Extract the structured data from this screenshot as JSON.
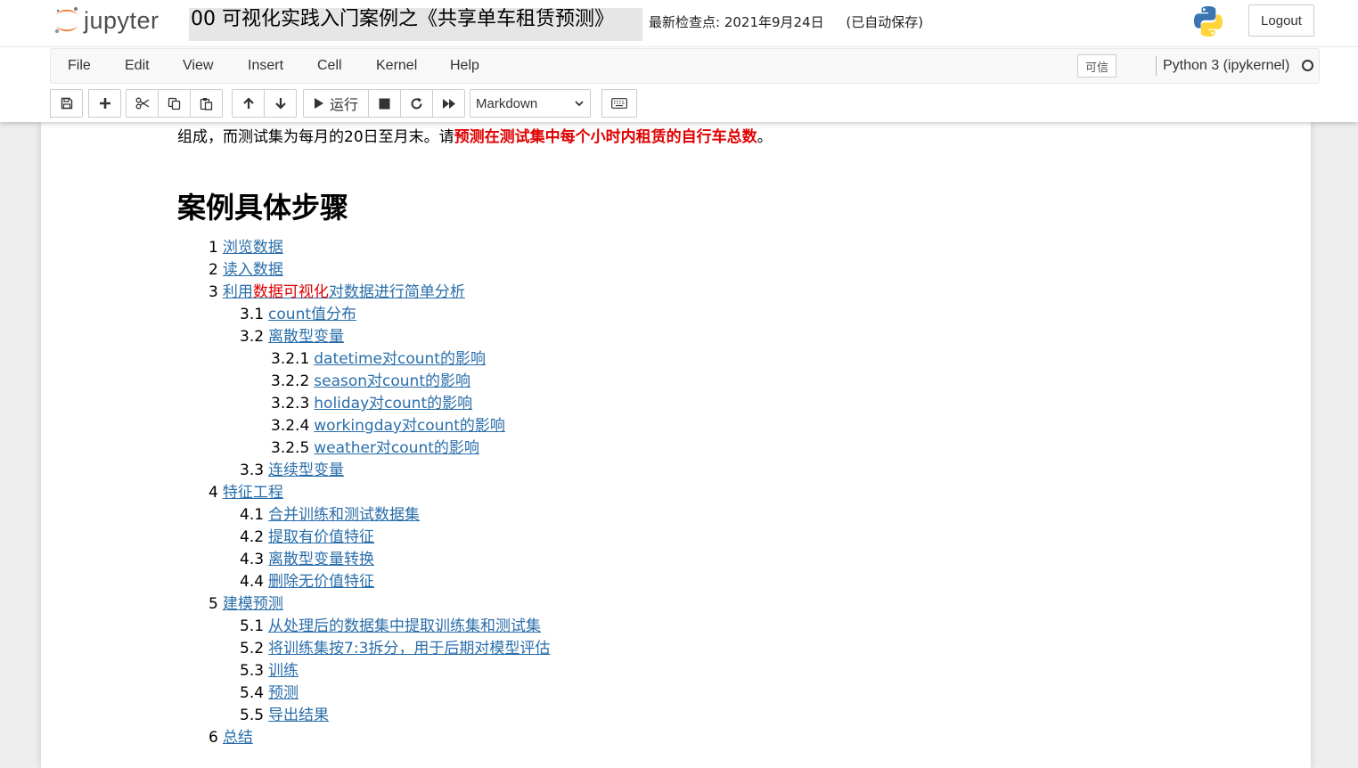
{
  "header": {
    "logo_text": "jupyter",
    "notebook_title": "00 可视化实践入门案例之《共享单车租赁预测》",
    "checkpoint": "最新检查点: 2021年9月24日",
    "autosave": "(已自动保存)",
    "logout_label": "Logout"
  },
  "menubar": {
    "items": [
      "File",
      "Edit",
      "View",
      "Insert",
      "Cell",
      "Kernel",
      "Help"
    ],
    "trusted_label": "可信",
    "kernel_name": "Python 3 (ipykernel)"
  },
  "toolbar": {
    "run_label": "运行",
    "cell_type": "Markdown"
  },
  "content": {
    "intro_prefix": "组成，而测试集为每月的20日至月末。请",
    "intro_red": "预测在测试集中每个小时内租赁的自行车总数",
    "intro_suffix": "。",
    "steps_title": "案例具体步骤",
    "toc": [
      {
        "num": "1",
        "text": "浏览数据",
        "level": 1
      },
      {
        "num": "2",
        "text": "读入数据",
        "level": 1
      },
      {
        "num": "3",
        "pre": "利用",
        "hl": "数据可视化",
        "post": "对数据进行简单分析",
        "level": 1
      },
      {
        "num": "3.1",
        "text": "count值分布",
        "level": 2
      },
      {
        "num": "3.2",
        "text": "离散型变量",
        "level": 2
      },
      {
        "num": "3.2.1",
        "text": "datetime对count的影响",
        "level": 3
      },
      {
        "num": "3.2.2",
        "text": "season对count的影响",
        "level": 3
      },
      {
        "num": "3.2.3",
        "text": "holiday对count的影响",
        "level": 3
      },
      {
        "num": "3.2.4",
        "text": "workingday对count的影响",
        "level": 3
      },
      {
        "num": "3.2.5",
        "text": "weather对count的影响",
        "level": 3
      },
      {
        "num": "3.3",
        "text": "连续型变量",
        "level": 2
      },
      {
        "num": "4",
        "text": "特征工程",
        "level": 1
      },
      {
        "num": "4.1",
        "text": "合并训练和测试数据集",
        "level": 2
      },
      {
        "num": "4.2",
        "text": "提取有价值特征",
        "level": 2
      },
      {
        "num": "4.3",
        "text": "离散型变量转换",
        "level": 2
      },
      {
        "num": "4.4",
        "text": "删除无价值特征",
        "level": 2
      },
      {
        "num": "5",
        "text": "建模预测",
        "level": 1
      },
      {
        "num": "5.1",
        "text": "从处理后的数据集中提取训练集和测试集",
        "level": 2
      },
      {
        "num": "5.2",
        "text": "将训练集按7:3拆分，用于后期对模型评估",
        "level": 2
      },
      {
        "num": "5.3",
        "text": "训练",
        "level": 2
      },
      {
        "num": "5.4",
        "text": "预测",
        "level": 2
      },
      {
        "num": "5.5",
        "text": "导出结果",
        "level": 2
      },
      {
        "num": "6",
        "text": "总结",
        "level": 1
      }
    ]
  },
  "colors": {
    "link": "#296eaa",
    "highlight_red": "#e00000",
    "jupyter_orange": "#f37726"
  }
}
